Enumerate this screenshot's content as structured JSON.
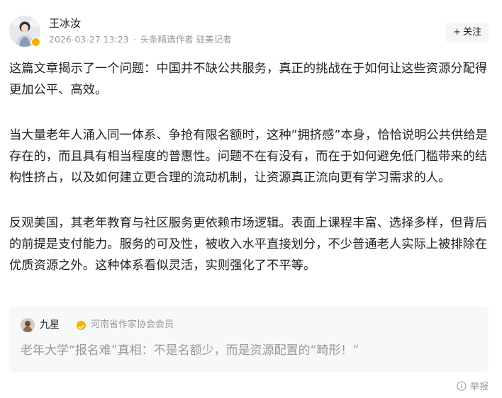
{
  "header": {
    "author_name": "王冰汝",
    "date": "2026-03-27 13:23",
    "separator": "·",
    "tags": "头条精选作者 驻美记者",
    "follow_icon": "+",
    "follow_label": "关注",
    "avatar_icon": "user-avatar",
    "verified_icon": "verified-badge-icon"
  },
  "article": {
    "paragraphs": [
      "这篇文章揭示了一个问题：中国并不缺公共服务，真正的挑战在于如何让这些资源分配得更加公平、高效。",
      "当大量老年人涌入同一体系、争抢有限名额时，这种”拥挤感”本身，恰恰说明公共供给是存在的，而且具有相当程度的普惠性。问题不在有没有，而在于如何避免低门槛带来的结构性挤占，以及如何建立更合理的流动机制，让资源真正流向更有学习需求的人。",
      "反观美国，其老年教育与社区服务更依赖市场逻辑。表面上课程丰富、选择多样，但背后的前提是支付能力。服务的可及性，被收入水平直接划分，不少普通老人实际上被排除在优质资源之外。这种体系看似灵活，实则强化了不平等。"
    ]
  },
  "quote": {
    "author": "九星",
    "description": "河南省作家协会会员",
    "text": "老年大学“报名难”真相：不是名额少，而是资源配置的“畸形！”"
  },
  "footer": {
    "report_label": "举报",
    "report_icon": "info-circle-icon"
  },
  "colors": {
    "text": "#222222",
    "muted": "#999999",
    "card_bg": "#f7f8f8",
    "badge": "#f0b400"
  }
}
